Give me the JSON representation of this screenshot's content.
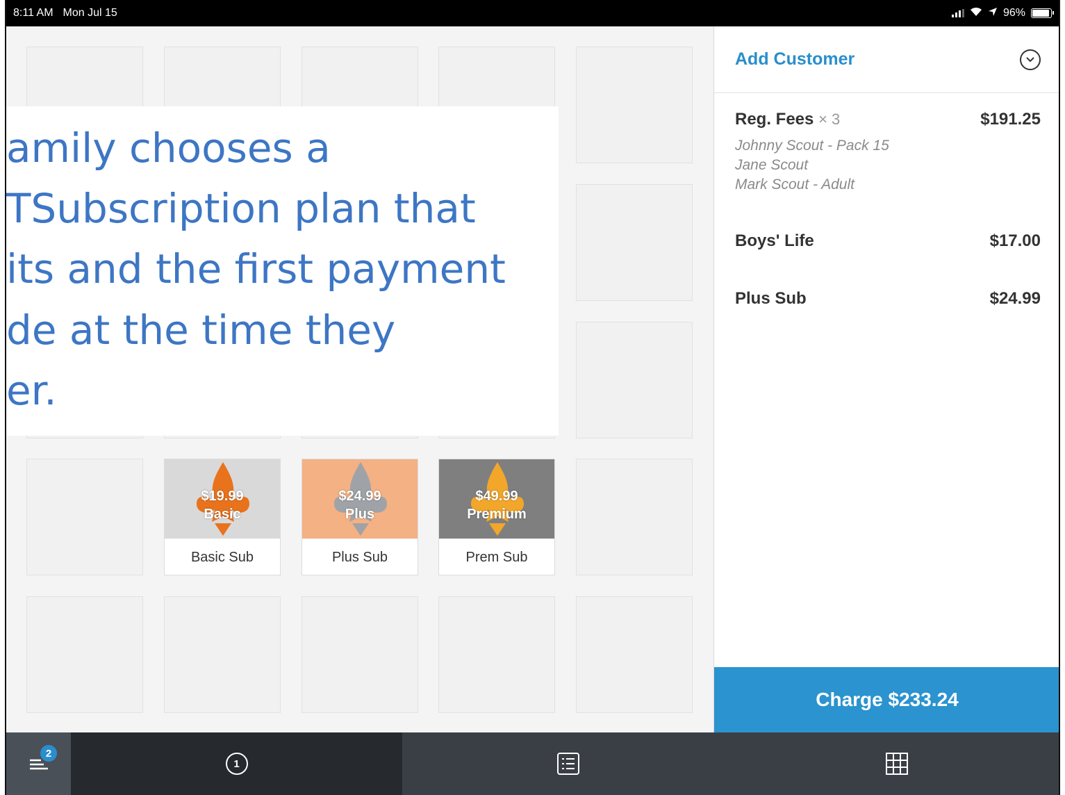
{
  "status_bar": {
    "time": "8:11 AM",
    "date": "Mon Jul 15",
    "battery": "96%"
  },
  "overlay": {
    "lines": [
      "amily chooses a",
      "TSubscription plan that",
      "its and the first payment",
      "de at the time they",
      "er."
    ]
  },
  "products": [
    {
      "price": "$19.99",
      "plan": "Basic",
      "name": "Basic Sub",
      "bg": "#d9d9d9",
      "emblem": "#e8731c"
    },
    {
      "price": "$24.99",
      "plan": "Plus",
      "name": "Plus Sub",
      "bg": "#f4b183",
      "emblem": "#9fa3a8"
    },
    {
      "price": "$49.99",
      "plan": "Premium",
      "name": "Prem Sub",
      "bg": "#7f7f7f",
      "emblem": "#f2a62a"
    }
  ],
  "cart": {
    "add_customer": "Add Customer",
    "items": [
      {
        "name": "Reg. Fees",
        "qty": "× 3",
        "price": "$191.25",
        "notes": [
          "Johnny Scout - Pack 15",
          "Jane Scout",
          "Mark Scout - Adult"
        ]
      },
      {
        "name": "Boys' Life",
        "price": "$17.00"
      },
      {
        "name": "Plus Sub",
        "price": "$24.99"
      }
    ],
    "charge_label": "Charge $233.24"
  },
  "bottom_nav": {
    "menu_badge": "2",
    "current_ticket": "1"
  },
  "colors": {
    "accent": "#2a8ecc",
    "charge": "#2b93cf",
    "overlay_text": "#3d76c4"
  }
}
